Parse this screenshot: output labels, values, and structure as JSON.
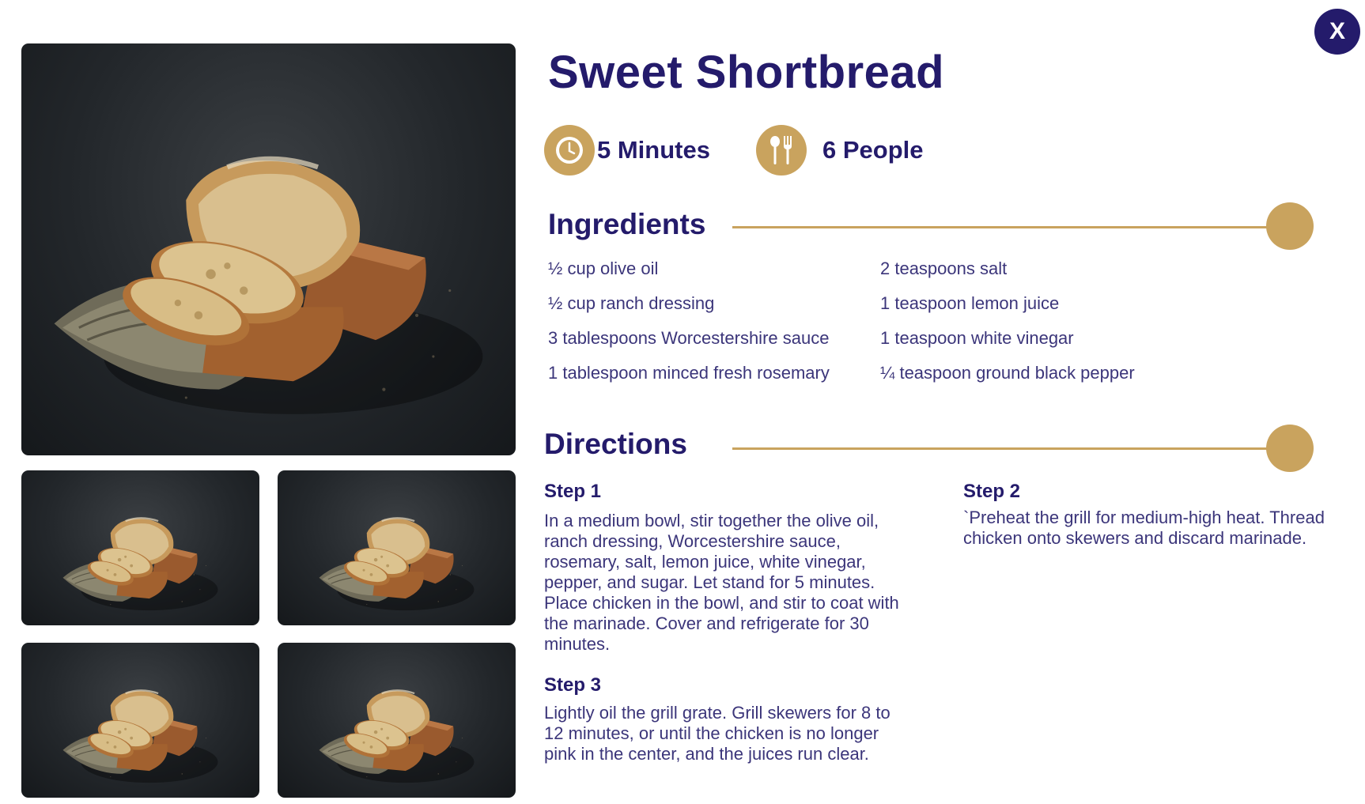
{
  "close_label": "X",
  "recipe": {
    "title": "Sweet Shortbread",
    "time": "5 Minutes",
    "servings": "6 People"
  },
  "ingredients": {
    "title": "Ingredients",
    "items": [
      "½ cup olive oil",
      "½ cup ranch dressing",
      "3 tablespoons Worcestershire sauce",
      "1 tablespoon minced fresh rosemary",
      "2 teaspoons salt",
      "1 teaspoon lemon juice",
      "1 teaspoon white vinegar",
      "¼ teaspoon ground black pepper"
    ]
  },
  "directions": {
    "title": "Directions",
    "steps": [
      {
        "label": "Step 1",
        "text": "In a medium bowl, stir together the olive oil, ranch dressing, Worcestershire sauce, rosemary, salt, lemon juice, white vinegar, pepper, and sugar. Let stand for 5 minutes. Place chicken in the bowl, and stir to coat with the marinade. Cover and refrigerate for 30 minutes."
      },
      {
        "label": "Step 2",
        "text": "`Preheat the grill for medium-high heat. Thread chicken onto skewers and discard marinade."
      },
      {
        "label": "Step 3",
        "text": "Lightly oil the grill grate. Grill skewers for 8 to 12 minutes, or until the chicken is no longer pink in the center, and the juices run clear."
      }
    ]
  },
  "colors": {
    "primary": "#241b6b",
    "accent": "#c9a35e",
    "text": "#3b357a",
    "photo_background": "#23272b"
  },
  "icons": [
    "close-icon",
    "clock-icon",
    "utensils-icon"
  ]
}
